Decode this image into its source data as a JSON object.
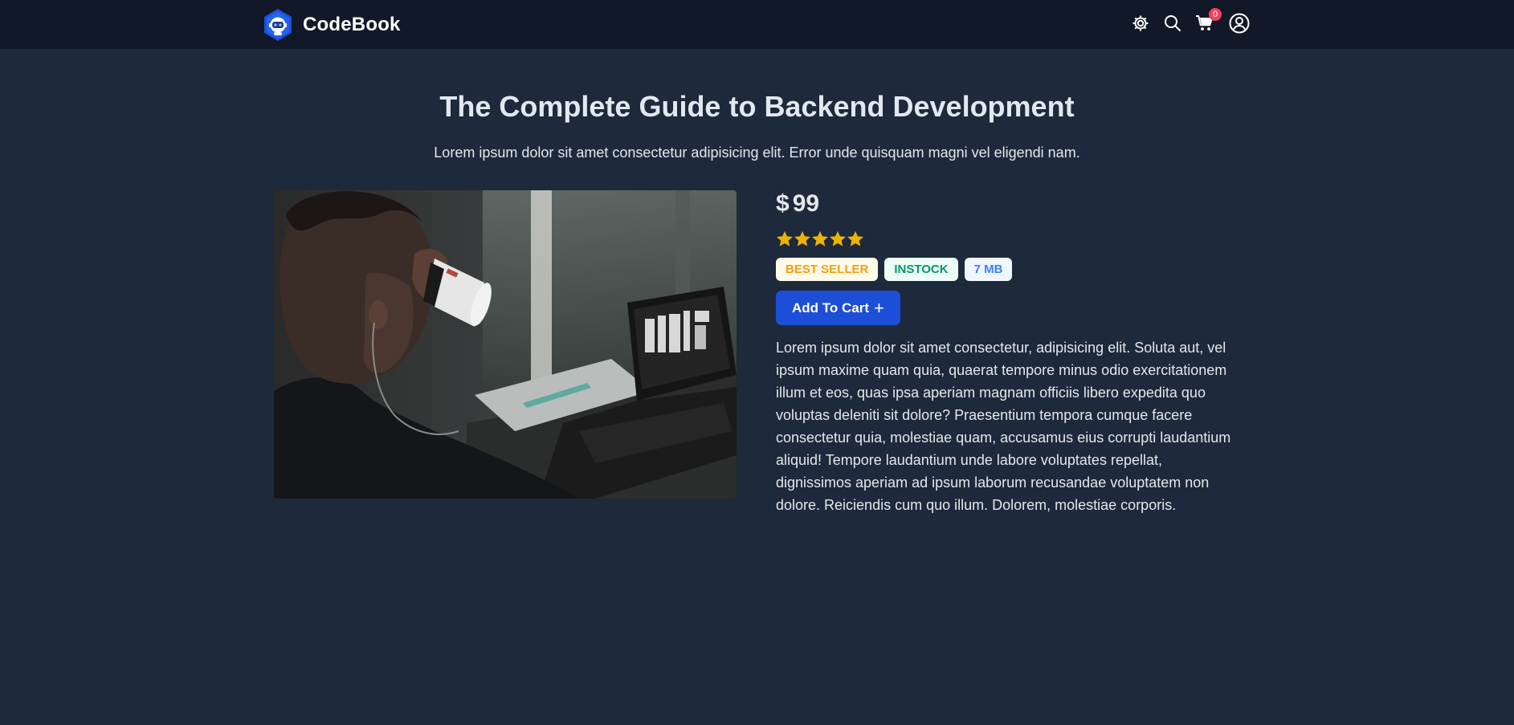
{
  "nav": {
    "brand_name": "CodeBook",
    "icons": [
      "gear-icon",
      "search-icon",
      "cart-icon",
      "user-icon"
    ],
    "cart_count": "0"
  },
  "product": {
    "title": "The Complete Guide to Backend Development",
    "overview": "Lorem ipsum dolor sit amet consectetur adipisicing elit. Error unde quisquam magni vel eligendi nam.",
    "image_icon": "person-drinking-coffee-at-laptop-photo",
    "currency": "$",
    "price": "99",
    "rating": 5,
    "rating_max": 5,
    "badges": {
      "best_seller": "BEST SELLER",
      "in_stock": "INSTOCK",
      "size": "7 MB"
    },
    "add_to_cart_label": "Add To Cart",
    "add_to_cart_icon": "+",
    "long_description": "Lorem ipsum dolor sit amet consectetur, adipisicing elit. Soluta aut, vel ipsum maxime quam quia, quaerat tempore minus odio exercitationem illum et eos, quas ipsa aperiam magnam officiis libero expedita quo voluptas deleniti sit dolore? Praesentium tempora cumque facere consectetur quia, molestiae quam, accusamus eius corrupti laudantium aliquid! Tempore laudantium unde labore voluptates repellat, dignissimos aperiam ad ipsum laborum recusandae voluptatem non dolore. Reiciendis cum quo illum. Dolorem, molestiae corporis."
  },
  "colors": {
    "page_bg": "#1e293b",
    "nav_bg": "#111827",
    "accent_button": "#1d4ed8",
    "star": "#eab308",
    "cart_badge": "#f43f5e"
  }
}
